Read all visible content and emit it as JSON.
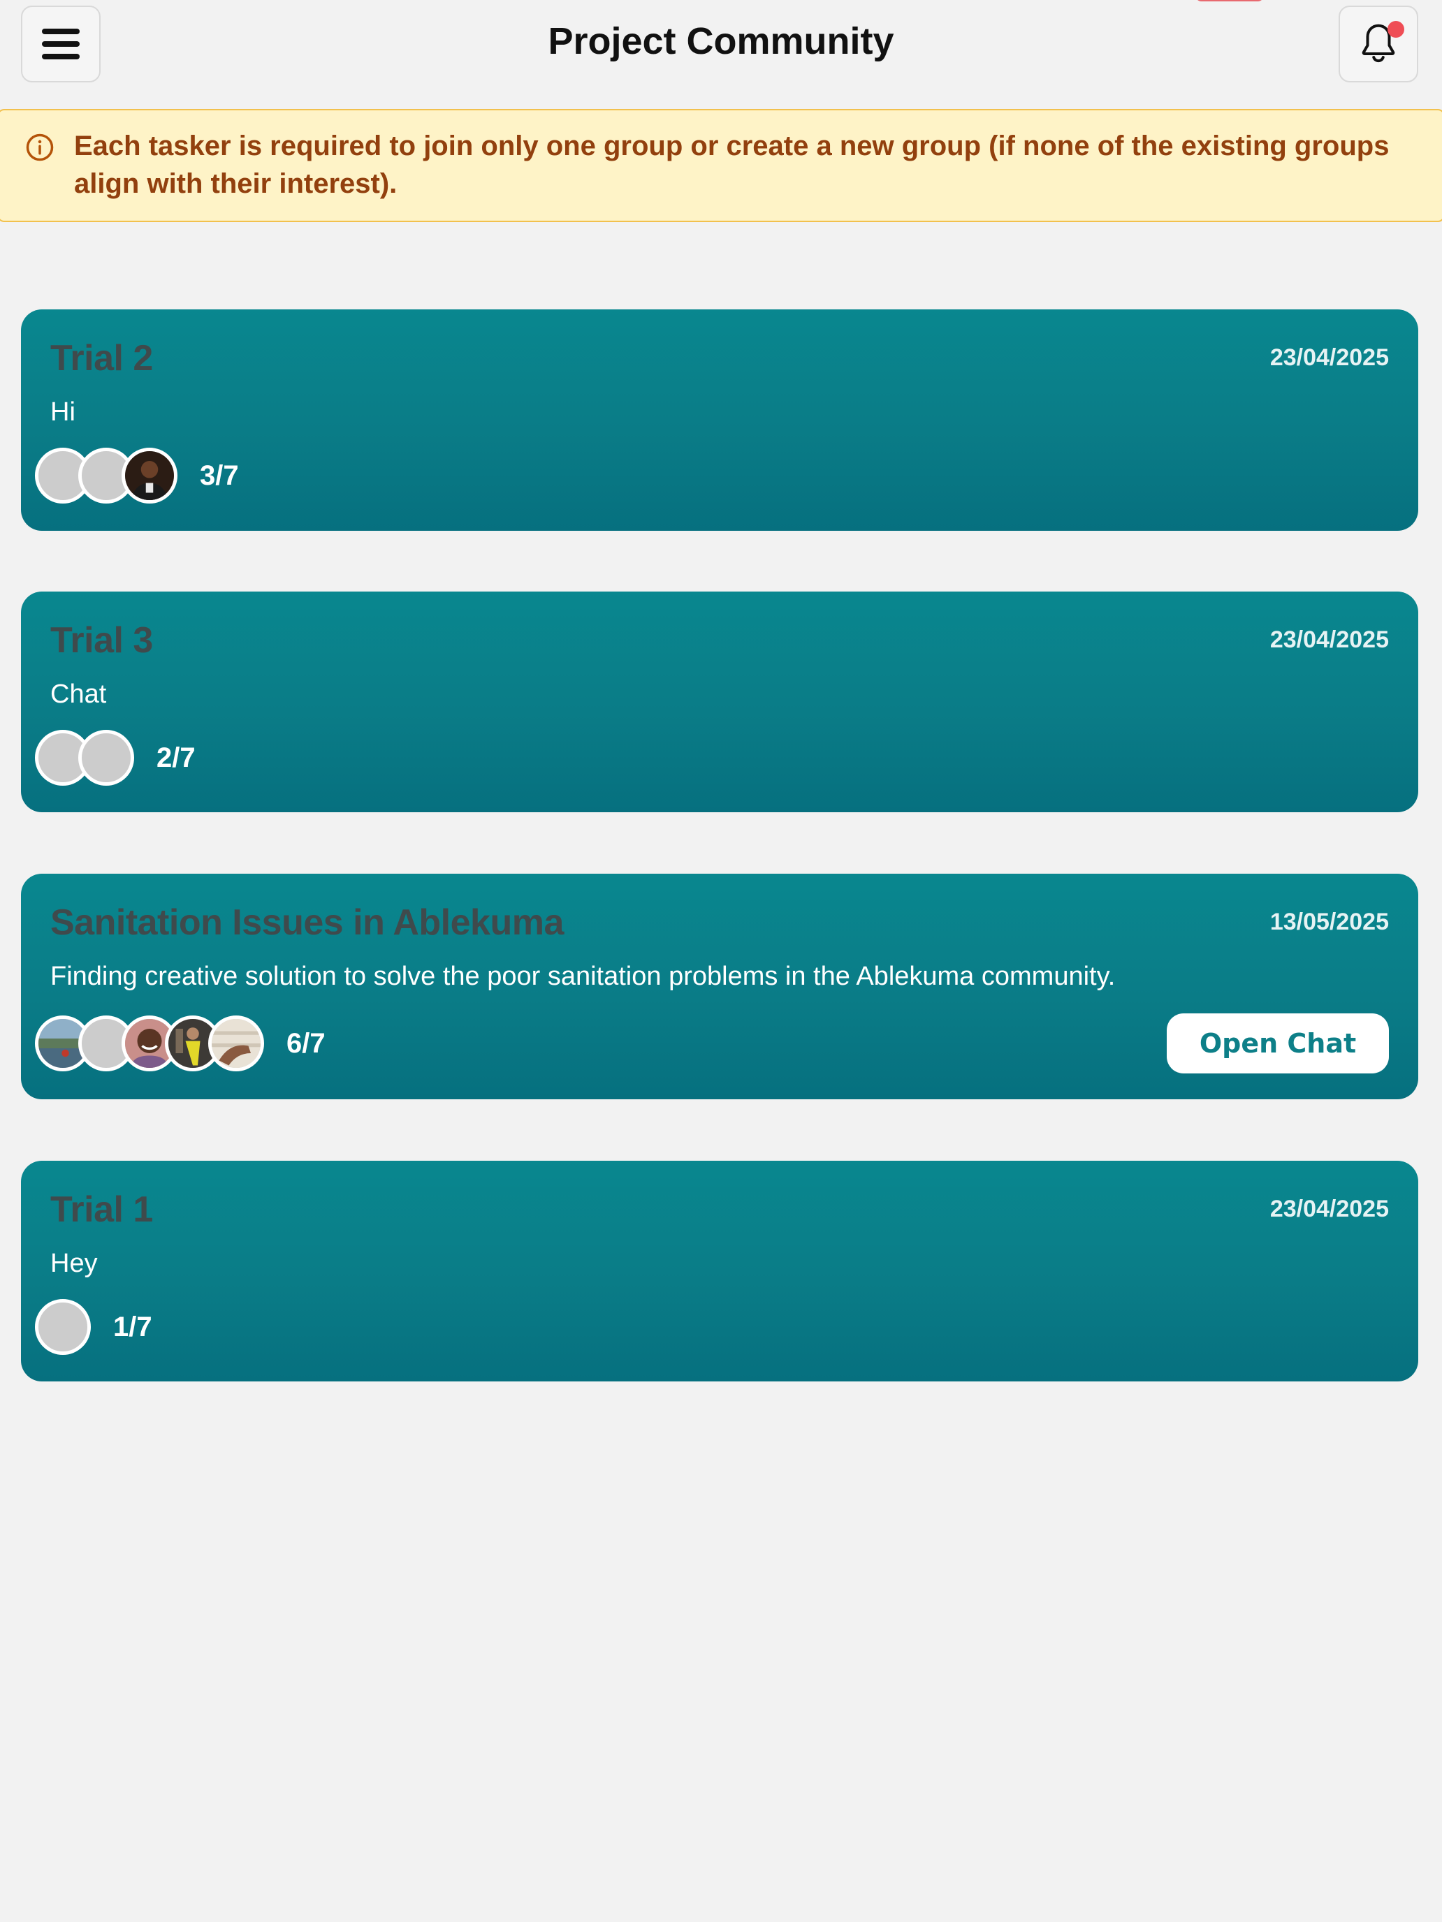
{
  "header": {
    "title": "Project Community",
    "menu_icon": "hamburger-menu-icon",
    "notification_icon": "bell-icon",
    "notification_dot_color": "#ef4d55"
  },
  "notice": {
    "icon": "info-circle-icon",
    "text": "Each tasker is required to join only one group or create a new group (if none of the existing groups align with their interest)."
  },
  "colors": {
    "card_gradient_top": "#09878f",
    "card_gradient_bottom": "#06707f",
    "notice_bg": "#fef3c7",
    "notice_text": "#92400e",
    "button_text": "#0d7f88"
  },
  "groups": [
    {
      "title": "Trial 2",
      "date": "23/04/2025",
      "description": "Hi",
      "members_count": "3/7",
      "avatars": [
        "placeholder",
        "placeholder",
        "photo-man-dark-shirt"
      ]
    },
    {
      "title": "Trial 3",
      "date": "23/04/2025",
      "description": "Chat",
      "members_count": "2/7",
      "avatars": [
        "placeholder",
        "placeholder"
      ]
    },
    {
      "title": "Sanitation Issues in Ablekuma",
      "date": "13/05/2025",
      "description": "Finding creative solution to solve the poor sanitation problems in the Ablekuma community.",
      "members_count": "6/7",
      "avatars": [
        "photo-landscape-water",
        "placeholder",
        "photo-woman-smiling",
        "photo-person-yellow",
        "photo-hand-light"
      ],
      "action_label": "Open Chat"
    },
    {
      "title": "Trial 1",
      "date": "23/04/2025",
      "description": "Hey",
      "members_count": "1/7",
      "avatars": [
        "placeholder"
      ]
    }
  ]
}
